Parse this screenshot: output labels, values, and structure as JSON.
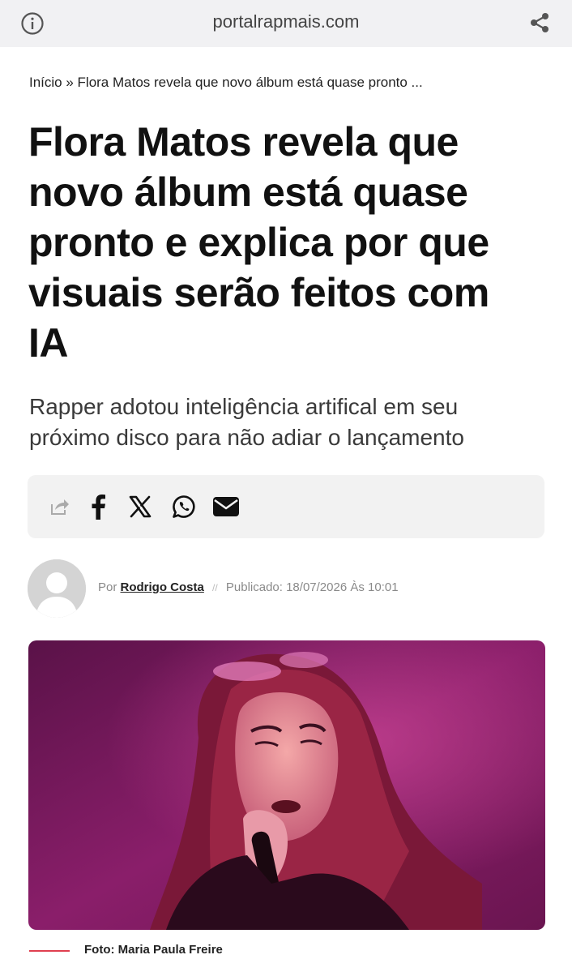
{
  "browser": {
    "url": "portalrapmais.com",
    "icons": {
      "info": "info-icon",
      "share": "share-icon"
    }
  },
  "article": {
    "breadcrumb": "Início » Flora Matos revela que novo álbum está quase pronto ...",
    "title_lines": [
      "Flora Matos revela que",
      "novo álbum está quase",
      "pronto e explica por que",
      "visuais serão feitos com",
      "IA"
    ],
    "subtitle_lines": [
      "Rapper adotou inteligência artifical em seu",
      "próximo disco para não adiar o lançamento"
    ]
  },
  "share_bar": {
    "icons": [
      "share-icon",
      "facebook-icon",
      "x-icon",
      "whatsapp-icon",
      "email-icon"
    ]
  },
  "byline": {
    "prefix": "Por",
    "author": "Rodrigo Costa",
    "separator": "//",
    "published": "Publicado: 18/07/2026 Às 10:01"
  },
  "photo": {
    "caption": "Foto: Maria Paula Freire"
  },
  "colors": {
    "accent": "#e04050",
    "topbar": "#f1f1f3",
    "share_bar_bg": "#f2f2f2"
  }
}
